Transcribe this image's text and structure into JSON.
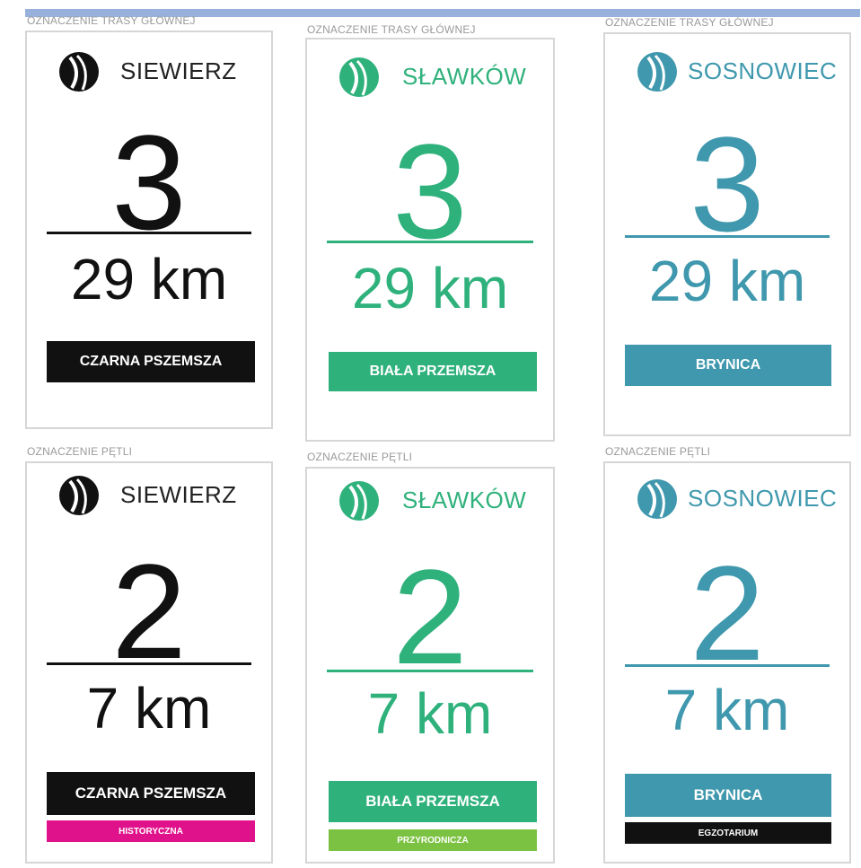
{
  "captions": {
    "main_route": "OZNACZENIE TRASY GŁÓWNEJ",
    "loop": "OZNACZENIE PĘTLI"
  },
  "colors": {
    "black": "#111111",
    "green": "#2fb17c",
    "teal": "#3f98ad",
    "magenta": "#e0128b",
    "lime": "#7cc242"
  },
  "signs": [
    {
      "city": "SIEWIERZ",
      "number": "3",
      "distance": "29 km",
      "river": "CZARNA PSZEMSZA",
      "logo_icon": "leaf-logo-icon"
    },
    {
      "city": "SŁAWKÓW",
      "number": "3",
      "distance": "29 km",
      "river": "BIAŁA PRZEMSZA",
      "logo_icon": "leaf-logo-icon"
    },
    {
      "city": "SOSNOWIEC",
      "number": "3",
      "distance": "29 km",
      "river": "BRYNICA",
      "logo_icon": "leaf-logo-icon"
    },
    {
      "city": "SIEWIERZ",
      "number": "2",
      "distance": "7 km",
      "river": "CZARNA PSZEMSZA",
      "theme": "HISTORYCZNA",
      "logo_icon": "leaf-logo-icon"
    },
    {
      "city": "SŁAWKÓW",
      "number": "2",
      "distance": "7 km",
      "river": "BIAŁA PRZEMSZA",
      "theme": "PRZYRODNICZA",
      "logo_icon": "leaf-logo-icon"
    },
    {
      "city": "SOSNOWIEC",
      "number": "2",
      "distance": "7 km",
      "river": "BRYNICA",
      "theme": "EGZOTARIUM",
      "logo_icon": "leaf-logo-icon"
    }
  ]
}
